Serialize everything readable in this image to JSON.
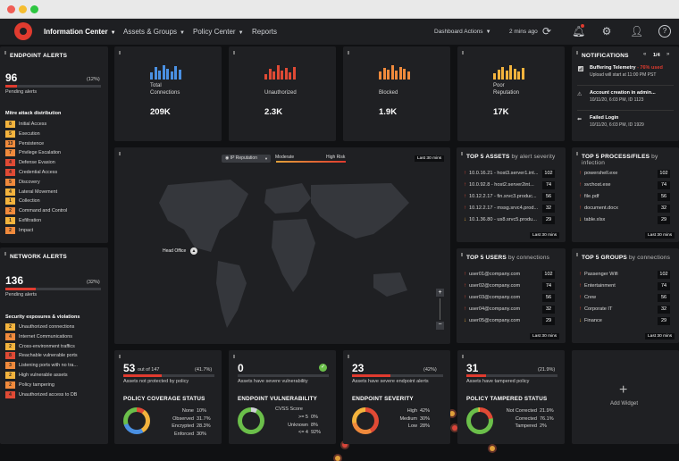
{
  "nav": {
    "items": [
      "Information Center",
      "Assets & Groups",
      "Policy Center",
      "Reports"
    ],
    "dashboard_actions": "Dashboard Actions",
    "updated": "2 mins ago"
  },
  "endpoint": {
    "title": "ENDPOINT ALERTS",
    "count": "96",
    "pct": "(12%)",
    "pct_value": 12,
    "label": "Pending alerts",
    "mitre_title": "Mitre attack distribution",
    "mitre": [
      {
        "n": "8",
        "l": "Initial Access"
      },
      {
        "n": "5",
        "l": "Execution"
      },
      {
        "n": "13",
        "l": "Persistence"
      },
      {
        "n": "7",
        "l": "Privilege Escalation"
      },
      {
        "n": "4",
        "l": "Defense Evasion"
      },
      {
        "n": "4",
        "l": "Credential Access"
      },
      {
        "n": "5",
        "l": "Discovery"
      },
      {
        "n": "4",
        "l": "Lateral Movement"
      },
      {
        "n": "1",
        "l": "Collection"
      },
      {
        "n": "2",
        "l": "Command and Control"
      },
      {
        "n": "1",
        "l": "Exfiltration"
      },
      {
        "n": "2",
        "l": "Impact"
      }
    ]
  },
  "network": {
    "title": "NETWORK ALERTS",
    "count": "136",
    "pct": "(32%)",
    "pct_value": 32,
    "label": "Pending alerts",
    "sec_title": "Security exposures & violations",
    "items": [
      {
        "n": "2",
        "l": "Unauthorized connections"
      },
      {
        "n": "4",
        "l": "Internet Communications"
      },
      {
        "n": "2",
        "l": "Cross-environment traffics"
      },
      {
        "n": "8",
        "l": "Reachable vulnerable ports"
      },
      {
        "n": "3",
        "l": "Listening ports with no tra..."
      },
      {
        "n": "2",
        "l": "High vulnerable assets"
      },
      {
        "n": "2",
        "l": "Policy tampering"
      },
      {
        "n": "4",
        "l": "Unauthorized access to DB"
      }
    ]
  },
  "tiles": [
    {
      "l1": "Total",
      "l2": "Connections",
      "v": "209K",
      "color": "#4a90e2"
    },
    {
      "l1": "",
      "l2": "Unauthorized",
      "v": "2.3K",
      "color": "#e04a35"
    },
    {
      "l1": "",
      "l2": "Blocked",
      "v": "1.9K",
      "color": "#f08a3c"
    },
    {
      "l1": "Poor",
      "l2": "Reputation",
      "v": "17K",
      "color": "#f3b33d"
    }
  ],
  "notifications": {
    "title": "NOTIFICATIONS",
    "page": "1/4",
    "items": [
      {
        "t": "Buffering Telemetry",
        "hl": " - 76% used",
        "d": "Upload will start at 11:00 PM PST"
      },
      {
        "t": "Account creation in admin...",
        "hl": "",
        "d": "10/11/20, 6:03 PM, ID 1123"
      },
      {
        "t": "Failed Login",
        "hl": "",
        "d": "10/11/20, 6:03 PM, ID 1929"
      }
    ]
  },
  "map": {
    "select": "IP Reputation",
    "moderate": "Moderate",
    "high": "High Risk",
    "range": "Last 30 mins",
    "head_office": "Head Office"
  },
  "top_assets": {
    "title": "TOP 5 ASSETS",
    "sub": " by alert severity",
    "rows": [
      {
        "l": "10.0.16.21 - host3.server1.int...",
        "v": "102"
      },
      {
        "l": "10.0.92.8 - host2.server2int...",
        "v": "74"
      },
      {
        "l": "10.12.2.17 - fin.srvc3.produc...",
        "v": "56"
      },
      {
        "l": "10.12.2.17 - mssg.srvc4.prod...",
        "v": "32"
      },
      {
        "l": "10.1.36.80 - us8.srvc5.produ...",
        "v": "29"
      }
    ],
    "range": "Last 30 mins"
  },
  "top_process": {
    "title": "TOP 5 PROCESS/FILES",
    "sub": " by infection",
    "rows": [
      {
        "l": "powershell.exe",
        "v": "102"
      },
      {
        "l": "svchost.exe",
        "v": "74"
      },
      {
        "l": "file.pdf",
        "v": "56"
      },
      {
        "l": "document.docx",
        "v": "32"
      },
      {
        "l": "table.xlsx",
        "v": "29"
      }
    ],
    "range": "Last 30 mins"
  },
  "top_users": {
    "title": "TOP 5 USERS",
    "sub": " by connections",
    "rows": [
      {
        "l": "user01@company.com",
        "v": "102"
      },
      {
        "l": "user02@company.com",
        "v": "74"
      },
      {
        "l": "user03@company.com",
        "v": "56"
      },
      {
        "l": "user04@company.com",
        "v": "32"
      },
      {
        "l": "user05@company.com",
        "v": "29"
      }
    ],
    "range": "Last 30 mins"
  },
  "top_groups": {
    "title": "TOP 5 GROUPS",
    "sub": " by connections",
    "rows": [
      {
        "l": "Passenger Wifi",
        "v": "102"
      },
      {
        "l": "Entertainment",
        "v": "74"
      },
      {
        "l": "Crew",
        "v": "56"
      },
      {
        "l": "Corporate IT",
        "v": "32"
      },
      {
        "l": "Finance",
        "v": "29"
      }
    ],
    "range": "Last 30 mins"
  },
  "policy": {
    "big": "53",
    "of": "out of 147",
    "pct": "(41.7%)",
    "pct_value": 41.7,
    "caption": "Assets not protected by policy",
    "title": "POLICY COVERAGE STATUS",
    "legend": [
      {
        "l": "None",
        "v": "10%"
      },
      {
        "l": "Observed",
        "v": "31.7%"
      },
      {
        "l": "Encrypted",
        "v": "28.3%"
      },
      {
        "l": "Enforced",
        "v": "30%"
      }
    ]
  },
  "vuln": {
    "big": "0",
    "caption": "Assets have severe vulnerability",
    "title": "ENDPOINT VULNERABILITY",
    "cvss": "CVSS Score",
    "legend": [
      {
        "l": ">= 5",
        "v": "0%"
      },
      {
        "l": "Unknown",
        "v": "8%"
      },
      {
        "l": "<= 4",
        "v": "92%"
      }
    ]
  },
  "severity": {
    "big": "23",
    "pct": "(42%)",
    "pct_value": 42,
    "caption": "Assets have severe endpoint alerts",
    "title": "ENDPOINT SEVERITY",
    "legend": [
      {
        "l": "High",
        "v": "42%"
      },
      {
        "l": "Medium",
        "v": "30%"
      },
      {
        "l": "Low",
        "v": "28%"
      }
    ]
  },
  "tampered": {
    "big": "31",
    "pct": "(21.9%)",
    "pct_value": 21.9,
    "caption": "Assets have tampered policy",
    "title": "POLICY TAMPERED STATUS",
    "legend": [
      {
        "l": "Not Corrected",
        "v": "21.9%"
      },
      {
        "l": "Corrected",
        "v": "76.1%"
      },
      {
        "l": "Tampered",
        "v": "2%"
      }
    ]
  },
  "add_widget": "Add Widget"
}
